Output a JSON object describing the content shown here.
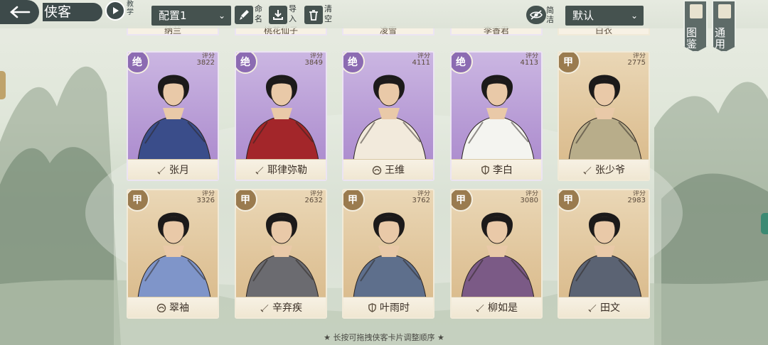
{
  "header": {
    "title": "侠客",
    "teach_label": "教学",
    "config_value": "配置1",
    "rename_label": "命名",
    "import_label": "导入",
    "clear_label": "清空",
    "filter_label": "简洁",
    "sort_value": "默认",
    "tab_atlas": "图鉴",
    "tab_general": "通用"
  },
  "partial_row": [
    {
      "name": "纳兰",
      "tier": "jue"
    },
    {
      "name": "桃花仙子",
      "tier": "jue"
    },
    {
      "name": "凌雪",
      "tier": "jue"
    },
    {
      "name": "李香君",
      "tier": "jue"
    },
    {
      "name": "白衣",
      "tier": "jia"
    }
  ],
  "cards": [
    {
      "name": "张月",
      "rank": "绝",
      "tier": "jue",
      "score_label": "评分",
      "score": "3822",
      "class_icon": "sword-icon",
      "accent": "#3a4d8a"
    },
    {
      "name": "耶律弥勒",
      "rank": "绝",
      "tier": "jue",
      "score_label": "评分",
      "score": "3849",
      "class_icon": "sword-icon",
      "accent": "#a3262a"
    },
    {
      "name": "王维",
      "rank": "绝",
      "tier": "jue",
      "score_label": "评分",
      "score": "4111",
      "class_icon": "lotus-icon",
      "accent": "#f2eadc"
    },
    {
      "name": "李白",
      "rank": "绝",
      "tier": "jue",
      "score_label": "评分",
      "score": "4113",
      "class_icon": "shield-icon",
      "accent": "#f4f4f0"
    },
    {
      "name": "张少爷",
      "rank": "甲",
      "tier": "jia",
      "score_label": "评分",
      "score": "2775",
      "class_icon": "sword-icon",
      "accent": "#b8ad8a"
    },
    {
      "name": "翠袖",
      "rank": "甲",
      "tier": "jia",
      "score_label": "评分",
      "score": "3326",
      "class_icon": "lotus-icon",
      "accent": "#7f95c9"
    },
    {
      "name": "辛弃疾",
      "rank": "甲",
      "tier": "jia",
      "score_label": "评分",
      "score": "2632",
      "class_icon": "sword-icon",
      "accent": "#6b6b70"
    },
    {
      "name": "叶雨时",
      "rank": "甲",
      "tier": "jia",
      "score_label": "评分",
      "score": "3762",
      "class_icon": "shield-icon",
      "accent": "#5e6f8c"
    },
    {
      "name": "柳如是",
      "rank": "甲",
      "tier": "jia",
      "score_label": "评分",
      "score": "3080",
      "class_icon": "sword-icon",
      "accent": "#7b5a86"
    },
    {
      "name": "田文",
      "rank": "甲",
      "tier": "jia",
      "score_label": "评分",
      "score": "2983",
      "class_icon": "sword-icon",
      "accent": "#5b6373"
    }
  ],
  "footer_hint": "★ 长按可拖拽侠客卡片调整顺序 ★"
}
